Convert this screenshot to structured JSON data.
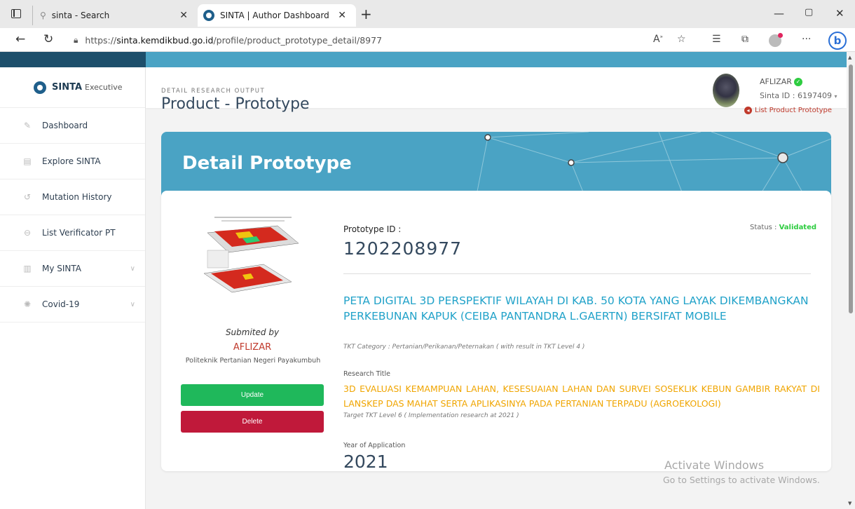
{
  "browser": {
    "tabs": [
      {
        "title": "sinta - Search"
      },
      {
        "title": "SINTA | Author Dashboard"
      }
    ],
    "url_prefix": "https://",
    "url_domain": "sinta.kemdikbud.go.id",
    "url_path": "/profile/product_prototype_detail/8977"
  },
  "sidebar": {
    "brand": "SINTA",
    "brand_sub": "Executive",
    "items": [
      {
        "label": "Dashboard"
      },
      {
        "label": "Explore SINTA"
      },
      {
        "label": "Mutation History"
      },
      {
        "label": "List Verificator PT"
      },
      {
        "label": "My SINTA"
      },
      {
        "label": "Covid-19"
      }
    ]
  },
  "header": {
    "user_name": "AFLIZAR",
    "sinta_id": "Sinta ID : 6197409"
  },
  "page": {
    "section_caption": "DETAIL RESEARCH OUTPUT",
    "title": "Product - Prototype",
    "back_link": "List Product Prototype",
    "banner_title": "Detail Prototype"
  },
  "detail": {
    "submitted_by_label": "Submited by",
    "submitter_name": "AFLIZAR",
    "submitter_institution": "Politeknik Pertanian Negeri Payakumbuh",
    "update_label": "Update",
    "delete_label": "Delete",
    "prototype_id_label": "Prototype ID :",
    "prototype_id": "1202208977",
    "status_label": "Status :",
    "status_value": "Validated",
    "product_title": "PETA DIGITAL 3D PERSPEKTIF WILAYAH DI KAB. 50 KOTA YANG LAYAK DIKEMBANGKAN PERKEBUNAN KAPUK (CEIBA PANTANDRA L.GAERTN) BERSIFAT MOBILE",
    "tkt_category": "TKT Category : Pertanian/Perikanan/Peternakan ( with result in TKT Level  4 )",
    "research_title_label": "Research Title",
    "research_title": "3D EVALUASI KEMAMPUAN LAHAN, KESESUAIAN LAHAN DAN SURVEI SOSEKLIK KEBUN GAMBIR RAKYAT DI LANSKEP DAS MAHAT SERTA APLIKASINYA PADA PERTANIAN TERPADU (AGROEKOLOGI)",
    "tkt_target": "Target TKT Level 6 ( Implementation research at  2021 )",
    "year_label": "Year of Application",
    "year_value": "2021"
  },
  "watermark": {
    "line1": "Activate Windows",
    "line2": "Go to Settings to activate Windows."
  }
}
